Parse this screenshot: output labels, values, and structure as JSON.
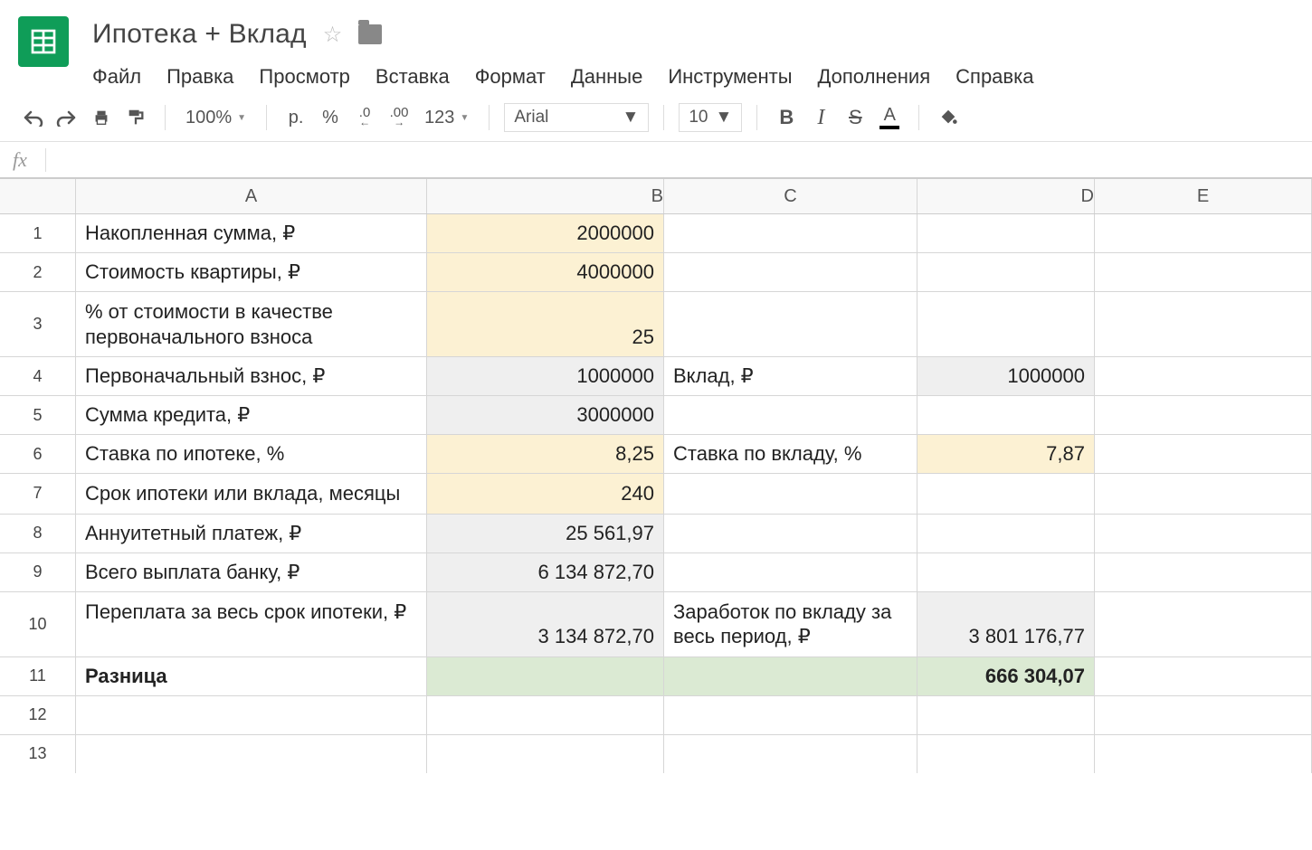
{
  "header": {
    "title": "Ипотека + Вклад"
  },
  "menu": {
    "file": "Файл",
    "edit": "Правка",
    "view": "Просмотр",
    "insert": "Вставка",
    "format": "Формат",
    "data": "Данные",
    "tools": "Инструменты",
    "addons": "Дополнения",
    "help": "Справка"
  },
  "toolbar": {
    "zoom": "100%",
    "currency": "р.",
    "percent": "%",
    "dec_less": ".0",
    "dec_more": ".00",
    "more_formats": "123",
    "font": "Arial",
    "font_size": "10",
    "bold": "B",
    "italic": "I",
    "strike": "S",
    "text_color": "A"
  },
  "columns": [
    "A",
    "B",
    "C",
    "D",
    "E"
  ],
  "rows": {
    "r1": {
      "n": "1",
      "A": "Накопленная сумма, ₽",
      "B": "2000000",
      "C": "",
      "D": "",
      "E": ""
    },
    "r2": {
      "n": "2",
      "A": "Стоимость квартиры, ₽",
      "B": "4000000",
      "C": "",
      "D": "",
      "E": ""
    },
    "r3": {
      "n": "3",
      "A": "% от стоимости в качестве первоначального взноса",
      "B": "25",
      "C": "",
      "D": "",
      "E": ""
    },
    "r4": {
      "n": "4",
      "A": "Первоначальный взнос, ₽",
      "B": "1000000",
      "C": "Вклад, ₽",
      "D": "1000000",
      "E": ""
    },
    "r5": {
      "n": "5",
      "A": "Сумма кредита, ₽",
      "B": "3000000",
      "C": "",
      "D": "",
      "E": ""
    },
    "r6": {
      "n": "6",
      "A": "Ставка по ипотеке, %",
      "B": "8,25",
      "C": "Ставка по вкладу, %",
      "D": "7,87",
      "E": ""
    },
    "r7": {
      "n": "7",
      "A": "Срок ипотеки или вклада, месяцы",
      "B": "240",
      "C": "",
      "D": "",
      "E": ""
    },
    "r8": {
      "n": "8",
      "A": "Аннуитетный платеж, ₽",
      "B": "25 561,97",
      "C": "",
      "D": "",
      "E": ""
    },
    "r9": {
      "n": "9",
      "A": "Всего выплата банку, ₽",
      "B": "6 134 872,70",
      "C": "",
      "D": "",
      "E": ""
    },
    "r10": {
      "n": "10",
      "A": "Переплата за весь срок ипотеки, ₽",
      "B": "3 134 872,70",
      "C": "Заработок по вкладу за весь период, ₽",
      "D": "3 801 176,77",
      "E": ""
    },
    "r11": {
      "n": "11",
      "A": "Разница",
      "B": "",
      "C": "",
      "D": "666 304,07",
      "E": ""
    },
    "r12": {
      "n": "12",
      "A": "",
      "B": "",
      "C": "",
      "D": "",
      "E": ""
    },
    "r13": {
      "n": "13",
      "A": "",
      "B": "",
      "C": "",
      "D": "",
      "E": ""
    }
  },
  "chart_data": {
    "type": "table",
    "title": "Ипотека + Вклад",
    "columns": [
      "A",
      "B",
      "C",
      "D"
    ],
    "rows": [
      [
        "Накопленная сумма, ₽",
        2000000,
        "",
        ""
      ],
      [
        "Стоимость квартиры, ₽",
        4000000,
        "",
        ""
      ],
      [
        "% от стоимости в качестве первоначального взноса",
        25,
        "",
        ""
      ],
      [
        "Первоначальный взнос, ₽",
        1000000,
        "Вклад, ₽",
        1000000
      ],
      [
        "Сумма кредита, ₽",
        3000000,
        "",
        ""
      ],
      [
        "Ставка по ипотеке, %",
        8.25,
        "Ставка по вкладу, %",
        7.87
      ],
      [
        "Срок ипотеки или вклада, месяцы",
        240,
        "",
        ""
      ],
      [
        "Аннуитетный платеж, ₽",
        25561.97,
        "",
        ""
      ],
      [
        "Всего выплата банку, ₽",
        6134872.7,
        "",
        ""
      ],
      [
        "Переплата за весь срок ипотеки, ₽",
        3134872.7,
        "Заработок по вкладу за весь период, ₽",
        3801176.77
      ],
      [
        "Разница",
        "",
        "",
        666304.07
      ]
    ]
  }
}
